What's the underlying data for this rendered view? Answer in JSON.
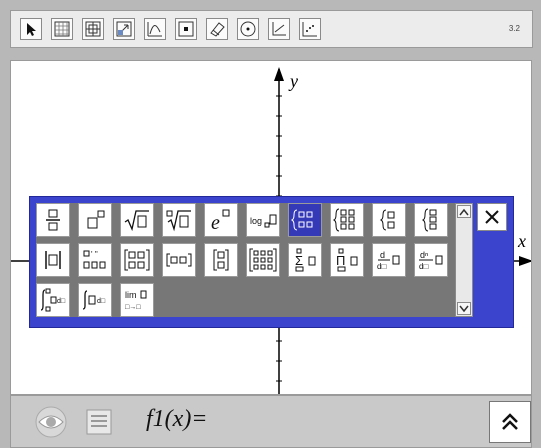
{
  "toolbar": {
    "tools": [
      {
        "icon": "pointer-icon"
      },
      {
        "icon": "grid-pattern-icon"
      },
      {
        "icon": "window-zoom-icon"
      },
      {
        "icon": "window-arrows-icon"
      },
      {
        "icon": "graph-icon"
      },
      {
        "icon": "point-icon"
      },
      {
        "icon": "eraser-icon"
      },
      {
        "icon": "circle-icon"
      },
      {
        "icon": "axes-icon"
      },
      {
        "icon": "scatter-icon"
      }
    ],
    "version": "3.2"
  },
  "canvas": {
    "x_label": "x",
    "y_label": "y"
  },
  "palette": {
    "rows": [
      [
        "fraction",
        "power",
        "sqrt",
        "nth-root",
        "exp",
        "log-base",
        "piecewise-2",
        "piecewise-3",
        "brace-2",
        "brace-3"
      ],
      [
        "abs",
        "derivative-primes",
        "matrix-2x2",
        "vector-row",
        "vector-col",
        "matrix-3x3",
        "sum",
        "product",
        "derivative",
        "nth-derivative"
      ],
      [
        "definite-integral",
        "integral",
        "limit"
      ]
    ],
    "selected": "piecewise-2"
  },
  "function_entry": {
    "name": "f1",
    "label_text": "f1(x)="
  }
}
